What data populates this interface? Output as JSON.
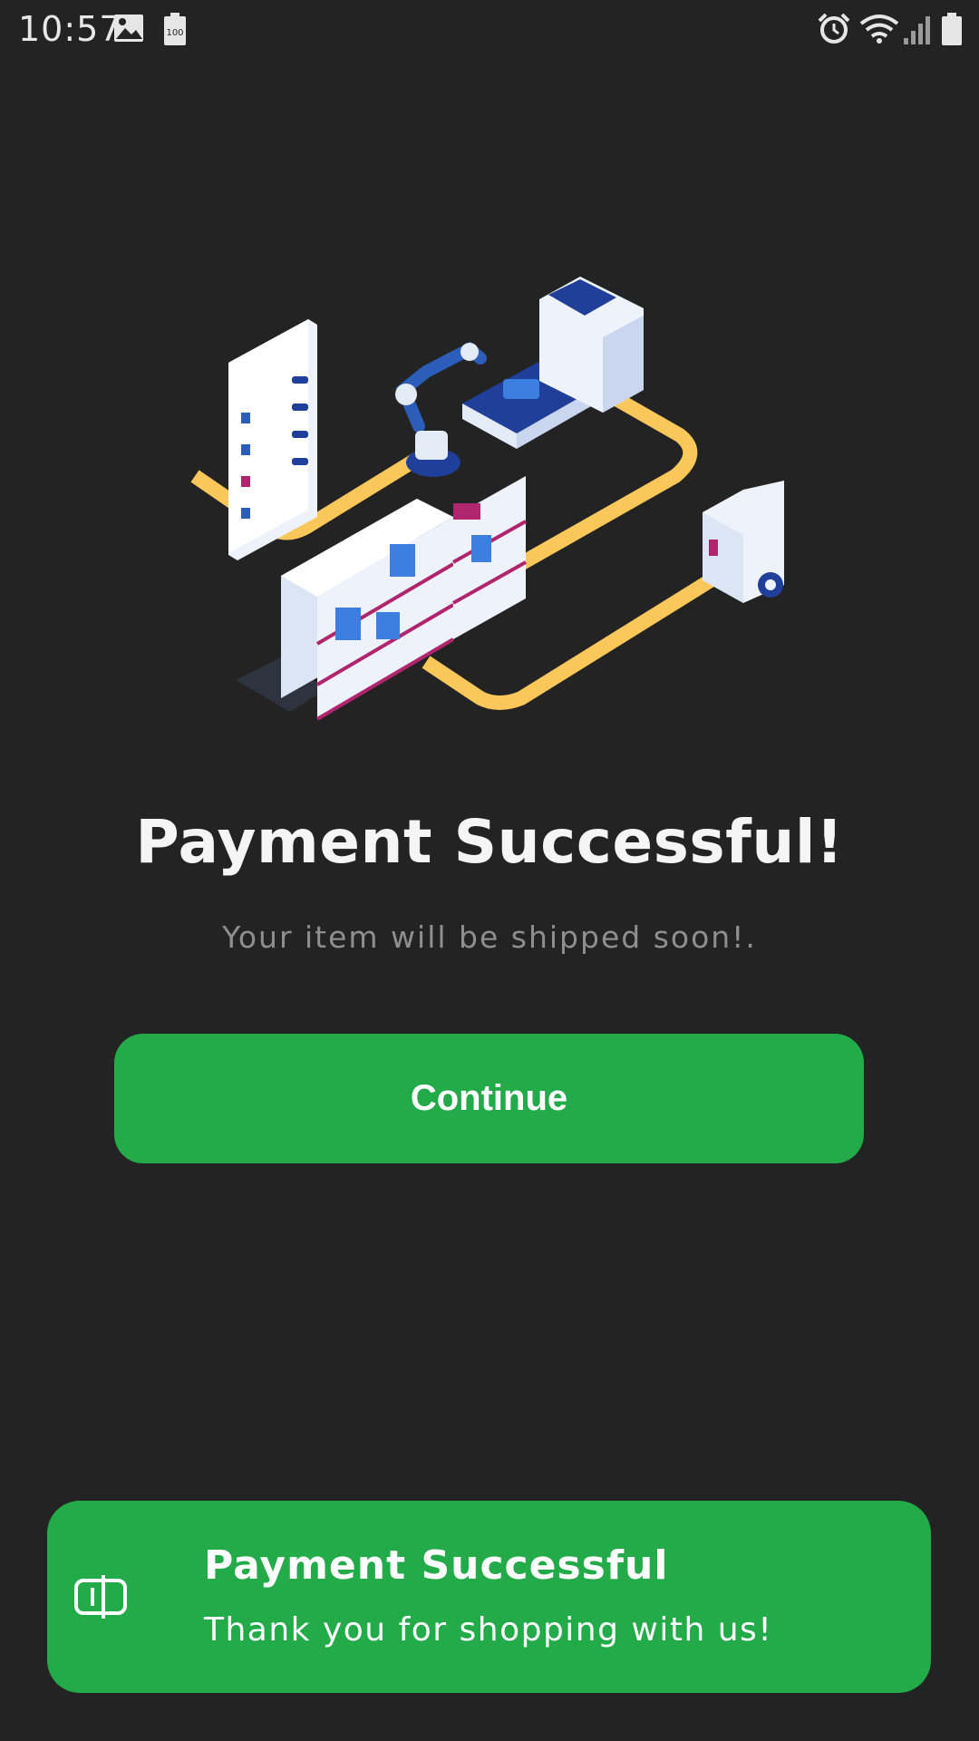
{
  "status_bar": {
    "time": "10:57",
    "battery_badge": "100",
    "left_icons": [
      "image-icon",
      "battery-saver-icon"
    ],
    "right_icons": [
      "alarm-icon",
      "wifi-icon",
      "cellular-signal-icon",
      "battery-icon"
    ]
  },
  "main": {
    "illustration": "warehouse-shipping-illustration",
    "title": "Payment Successful!",
    "subtitle": "Your item will be shipped soon!.",
    "continue_label": "Continue"
  },
  "toast": {
    "icon": "card-icon",
    "title": "Payment Successful",
    "message": "Thank you for shopping with us!"
  },
  "colors": {
    "background": "#232323",
    "primary_green": "#22ab48",
    "subtitle_gray": "#8f8f8f",
    "track_yellow": "#f9c75a",
    "accent_blue": "#1f3f9a"
  }
}
